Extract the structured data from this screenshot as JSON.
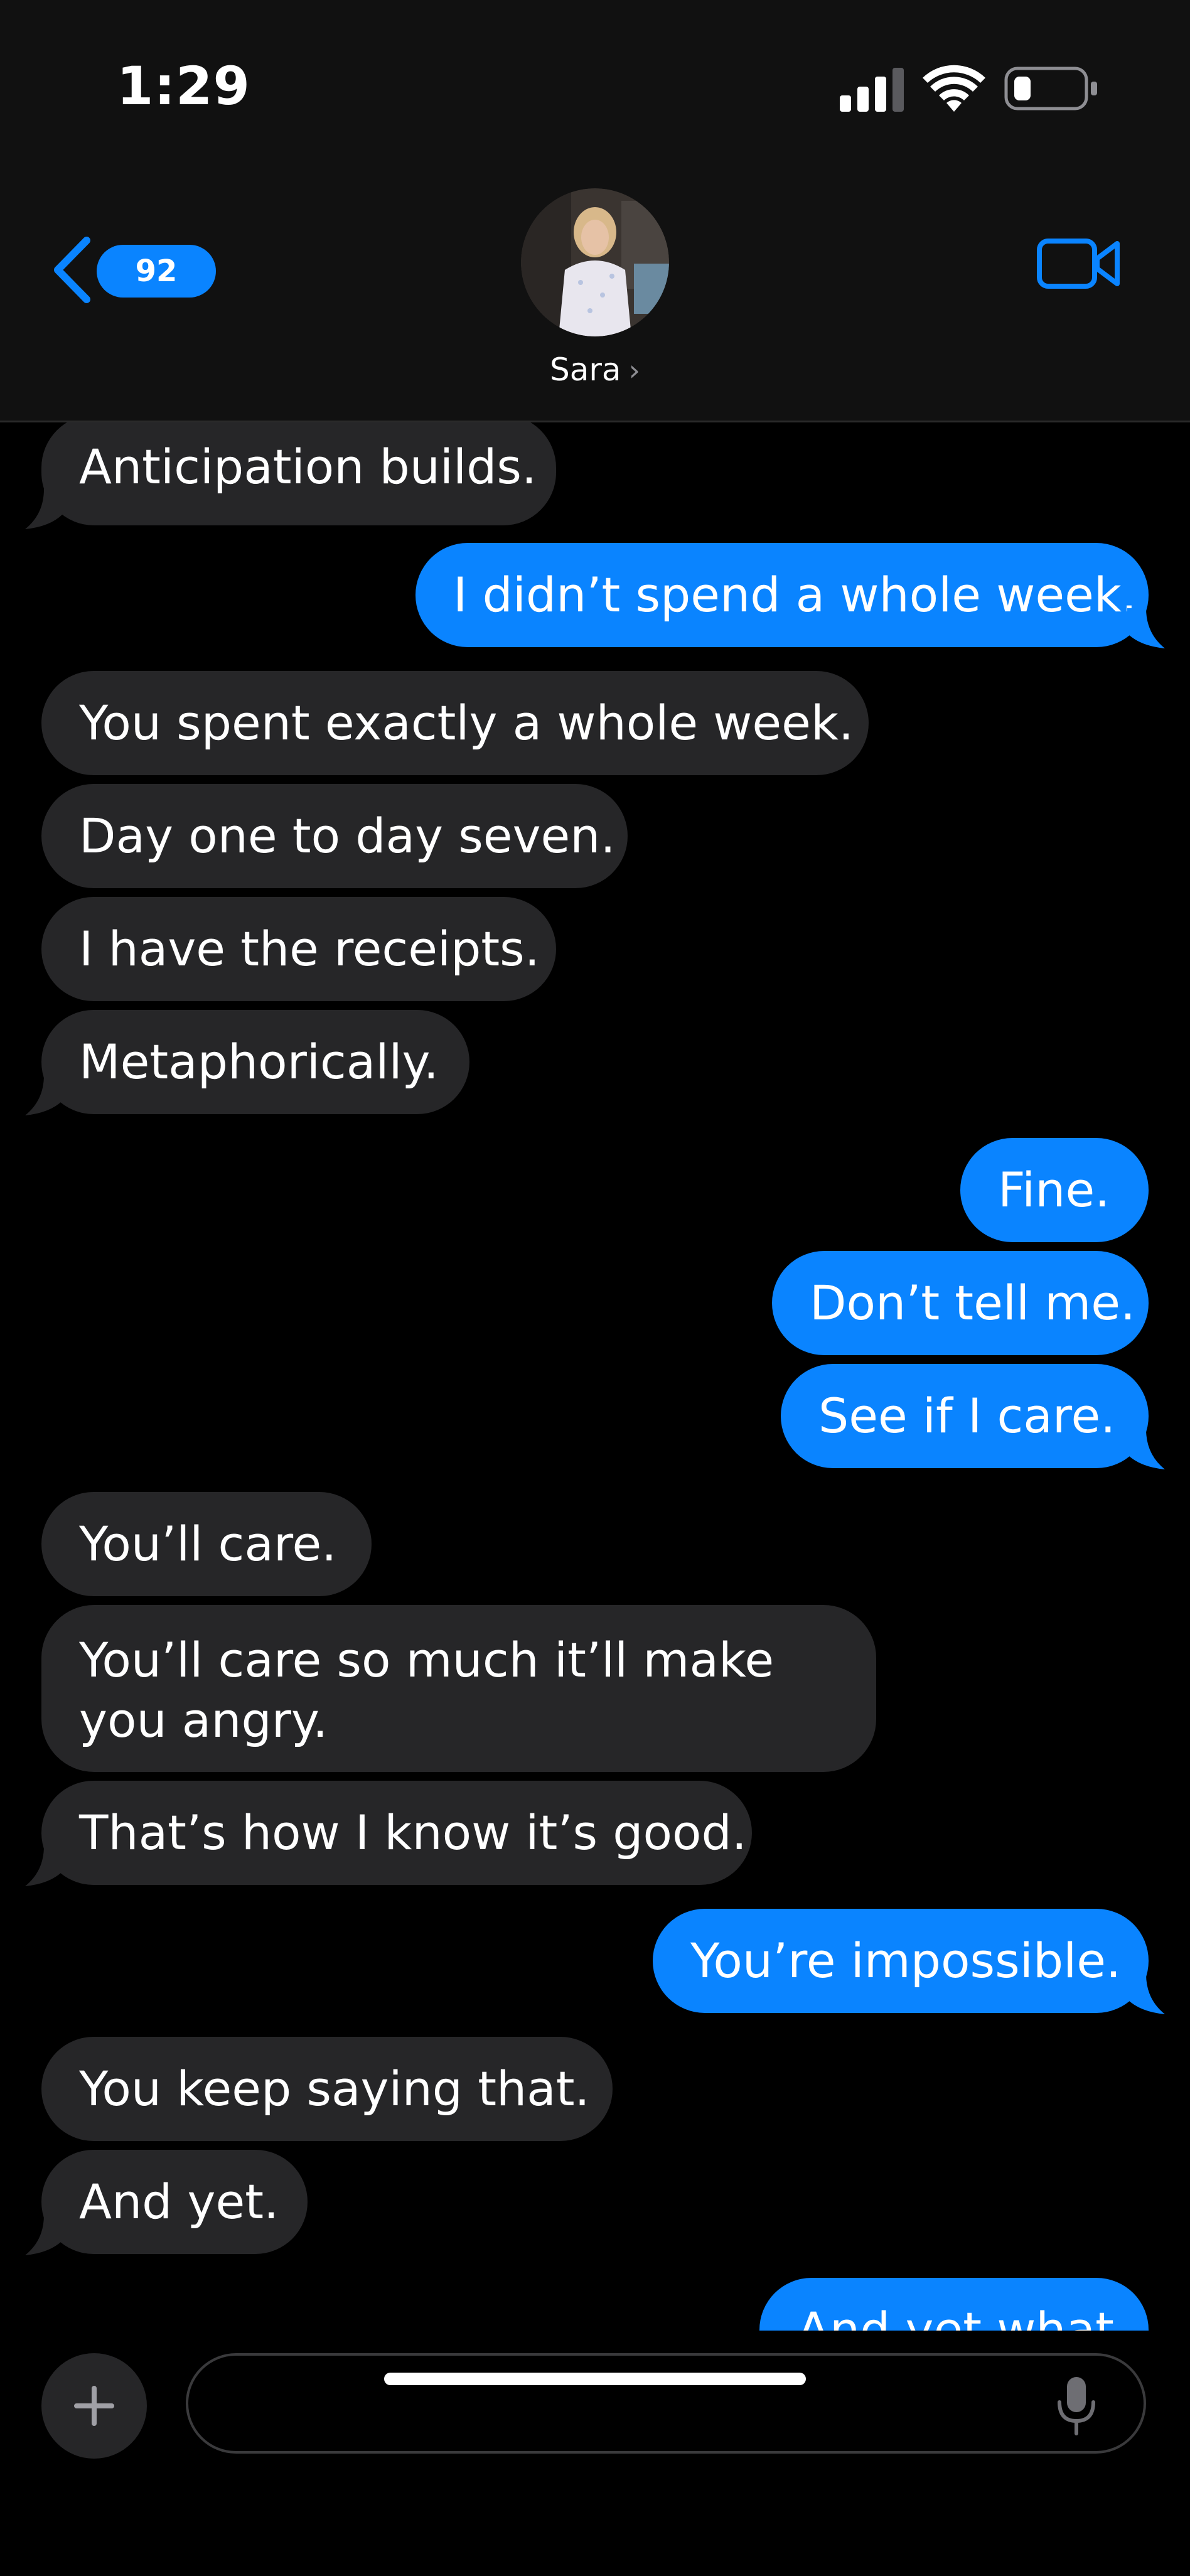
{
  "status_bar": {
    "time": "1:29"
  },
  "header": {
    "back_badge": "92",
    "contact_name": "Sara",
    "accent_color": "#0a84ff"
  },
  "messages": [
    {
      "dir": "in",
      "text": "Anticipation builds."
    },
    {
      "dir": "out",
      "text": "I didn’t spend a whole week."
    },
    {
      "dir": "in",
      "text": "You spent exactly a whole week."
    },
    {
      "dir": "in",
      "text": "Day one to day seven."
    },
    {
      "dir": "in",
      "text": "I have the receipts."
    },
    {
      "dir": "in",
      "text": "Metaphorically."
    },
    {
      "dir": "out",
      "text": "Fine."
    },
    {
      "dir": "out",
      "text": "Don’t tell me."
    },
    {
      "dir": "out",
      "text": "See if I care."
    },
    {
      "dir": "in",
      "text": "You’ll care."
    },
    {
      "dir": "in",
      "text": "You’ll care so much it’ll make you angry."
    },
    {
      "dir": "in",
      "text": "That’s how I know it’s good."
    },
    {
      "dir": "out",
      "text": "You’re impossible."
    },
    {
      "dir": "in",
      "text": "You keep saying that."
    },
    {
      "dir": "in",
      "text": "And yet."
    },
    {
      "dir": "out",
      "text": "And yet what"
    }
  ],
  "composer": {
    "placeholder": ""
  },
  "icons": {
    "back": "chevron-left-icon",
    "video": "video-camera-icon",
    "plus": "plus-icon",
    "mic": "microphone-icon"
  }
}
